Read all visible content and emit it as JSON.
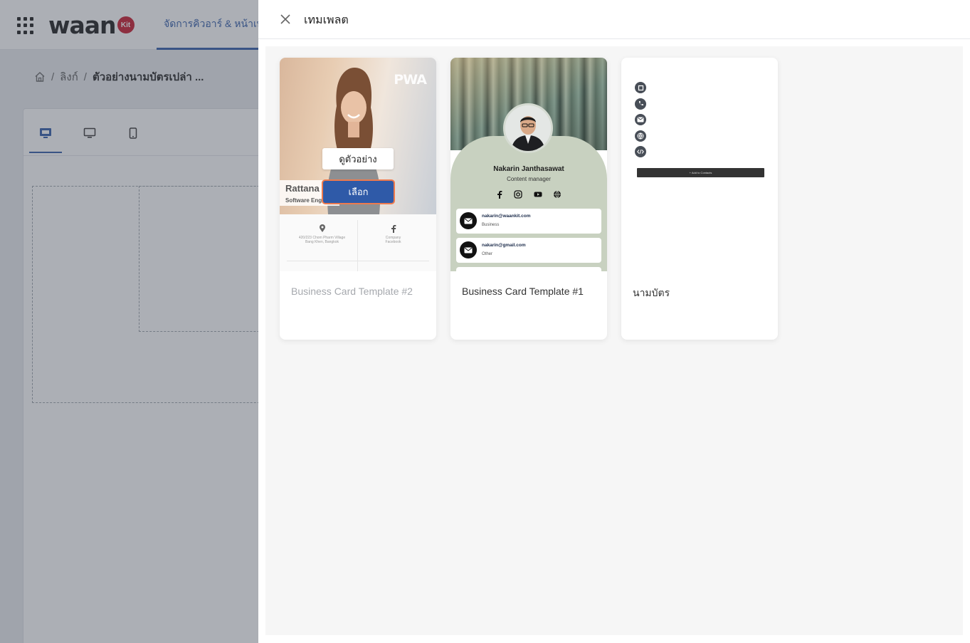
{
  "app": {
    "logo_text": "waan",
    "logo_badge": "Kit",
    "nav_tab_label": "จัดการคิวอาร์ & หน้าเพจ"
  },
  "breadcrumb": {
    "items": [
      "ลิงก์",
      "ตัวอย่างนามบัตรเปล่า ..."
    ],
    "separator": "/"
  },
  "drawer": {
    "title": "เทมเพลต",
    "close_icon": "close-icon"
  },
  "templates": [
    {
      "label": "Business Card Template #2",
      "preview_button": "ดูตัวอย่าง",
      "select_button": "เลือก",
      "thumb": {
        "brand": "PWA",
        "name": "Rattana",
        "role": "Software Engineer",
        "address_line1": "420/223 Chom Pharm Village",
        "address_line2": "Bang Khen, Bangkok",
        "social_line1": "Company",
        "social_line2": "Facebook"
      }
    },
    {
      "label": "Business Card Template #1",
      "thumb": {
        "name": "Nakarin Janthasawat",
        "role": "Content manager",
        "rows": [
          {
            "email": "nakarin@waankit.com",
            "type": "Business"
          },
          {
            "email": "nakarin@gmail.com",
            "type": "Other"
          }
        ]
      }
    },
    {
      "label": "นามบัตร",
      "thumb": {
        "button_text": "+ Add to Contacts"
      }
    }
  ],
  "colors": {
    "primary": "#2f5aa8",
    "select_outline": "#ee7a4d",
    "logo_badge": "#c7162b"
  }
}
